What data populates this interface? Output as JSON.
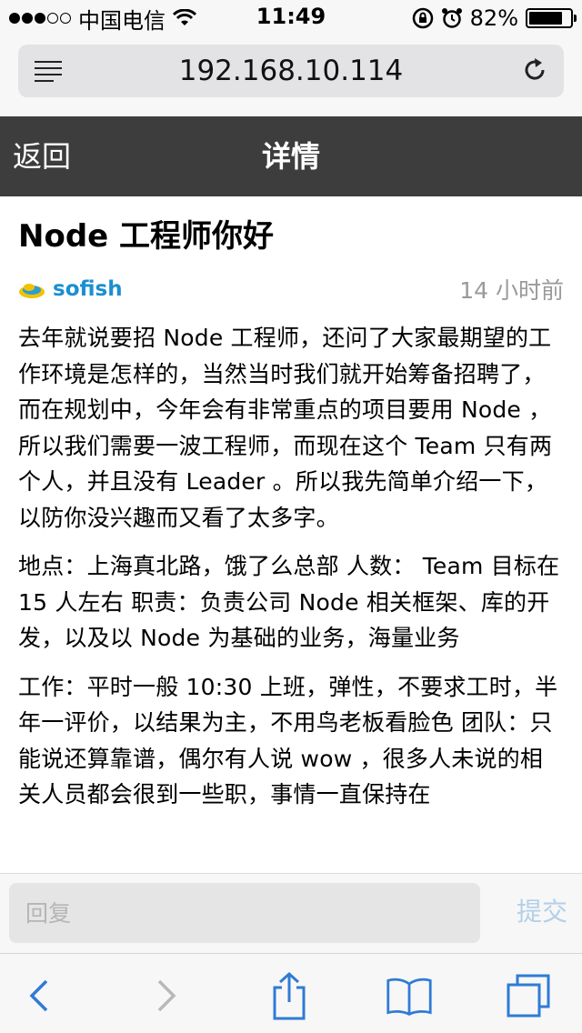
{
  "status_bar": {
    "signal_filled": 3,
    "signal_total": 5,
    "carrier": "中国电信",
    "time": "11:49",
    "battery_text": "82%",
    "battery_level": 0.82
  },
  "browser": {
    "url": "192.168.10.114"
  },
  "navbar": {
    "back_label": "返回",
    "title": "详情"
  },
  "post": {
    "title": "Node 工程师你好",
    "author": "sofish",
    "time_ago": "14 小时前",
    "paragraphs": [
      "去年就说要招 Node 工程师，还问了大家最期望的工作环境是怎样的，当然当时我们就开始筹备招聘了，而在规划中，今年会有非常重点的项目要用 Node ，所以我们需要一波工程师，而现在这个 Team 只有两个人，并且没有 Leader 。所以我先简单介绍一下，以防你没兴趣而又看了太多字。",
      "地点：上海真北路，饿了么总部 人数： Team 目标在 15 人左右 职责：负责公司 Node 相关框架、库的开发，以及以 Node 为基础的业务，海量业务",
      "工作：平时一般 10:30 上班，弹性，不要求工时，半年一评价，以结果为主，不用鸟老板看脸色 团队：只能说还算靠谱，偶尔有人说 wow ，很多人未说的相关人员都会很到一些职，事情一直保持在"
    ]
  },
  "reply": {
    "placeholder": "回复",
    "submit_label": "提交"
  },
  "colors": {
    "navbar_bg": "#3d3d3d",
    "author_link": "#1a8fd1",
    "toolbar_icon": "#2f7bd6",
    "toolbar_icon_disabled": "#b8b8b8",
    "submit_disabled": "#b3cfe9"
  },
  "toolbar": {
    "icons": [
      "back-icon",
      "forward-icon",
      "share-icon",
      "bookmarks-icon",
      "tabs-icon"
    ]
  }
}
